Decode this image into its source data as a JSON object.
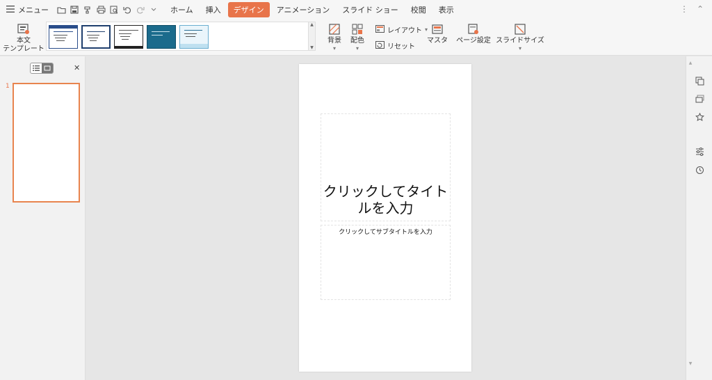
{
  "menubar": {
    "menu_label": "メニュー",
    "tabs": [
      {
        "label": "ホーム",
        "active": false
      },
      {
        "label": "挿入",
        "active": false
      },
      {
        "label": "デザイン",
        "active": true
      },
      {
        "label": "アニメーション",
        "active": false
      },
      {
        "label": "スライド ショー",
        "active": false
      },
      {
        "label": "校閲",
        "active": false
      },
      {
        "label": "表示",
        "active": false
      }
    ],
    "quick_access_icons": [
      "open-icon",
      "save-icon",
      "format-painter-icon",
      "print-icon",
      "print-preview-icon",
      "undo-icon",
      "redo-icon",
      "customize-icon"
    ]
  },
  "ribbon": {
    "body_template_label_1": "本文",
    "body_template_label_2": "テンプレート",
    "background_label": "背景",
    "color_scheme_label": "配色",
    "layout_label": "レイアウト",
    "reset_label": "リセット",
    "master_label": "マスタ",
    "page_setup_label": "ページ設定",
    "slide_size_label": "スライドサイズ",
    "template_thumbnails": [
      {
        "style": "blue-corner"
      },
      {
        "style": "navy-frame"
      },
      {
        "style": "plain"
      },
      {
        "style": "teal"
      },
      {
        "style": "light-blue"
      }
    ]
  },
  "left_panel": {
    "slide_number": "1"
  },
  "slide": {
    "title_placeholder": "クリックしてタイトルを入力",
    "subtitle_placeholder": "クリックしてサブタイトルを入力"
  },
  "colors": {
    "accent": "#e8744a",
    "panel_bg": "#f2f2f2",
    "canvas_bg": "#e6e6e6"
  }
}
